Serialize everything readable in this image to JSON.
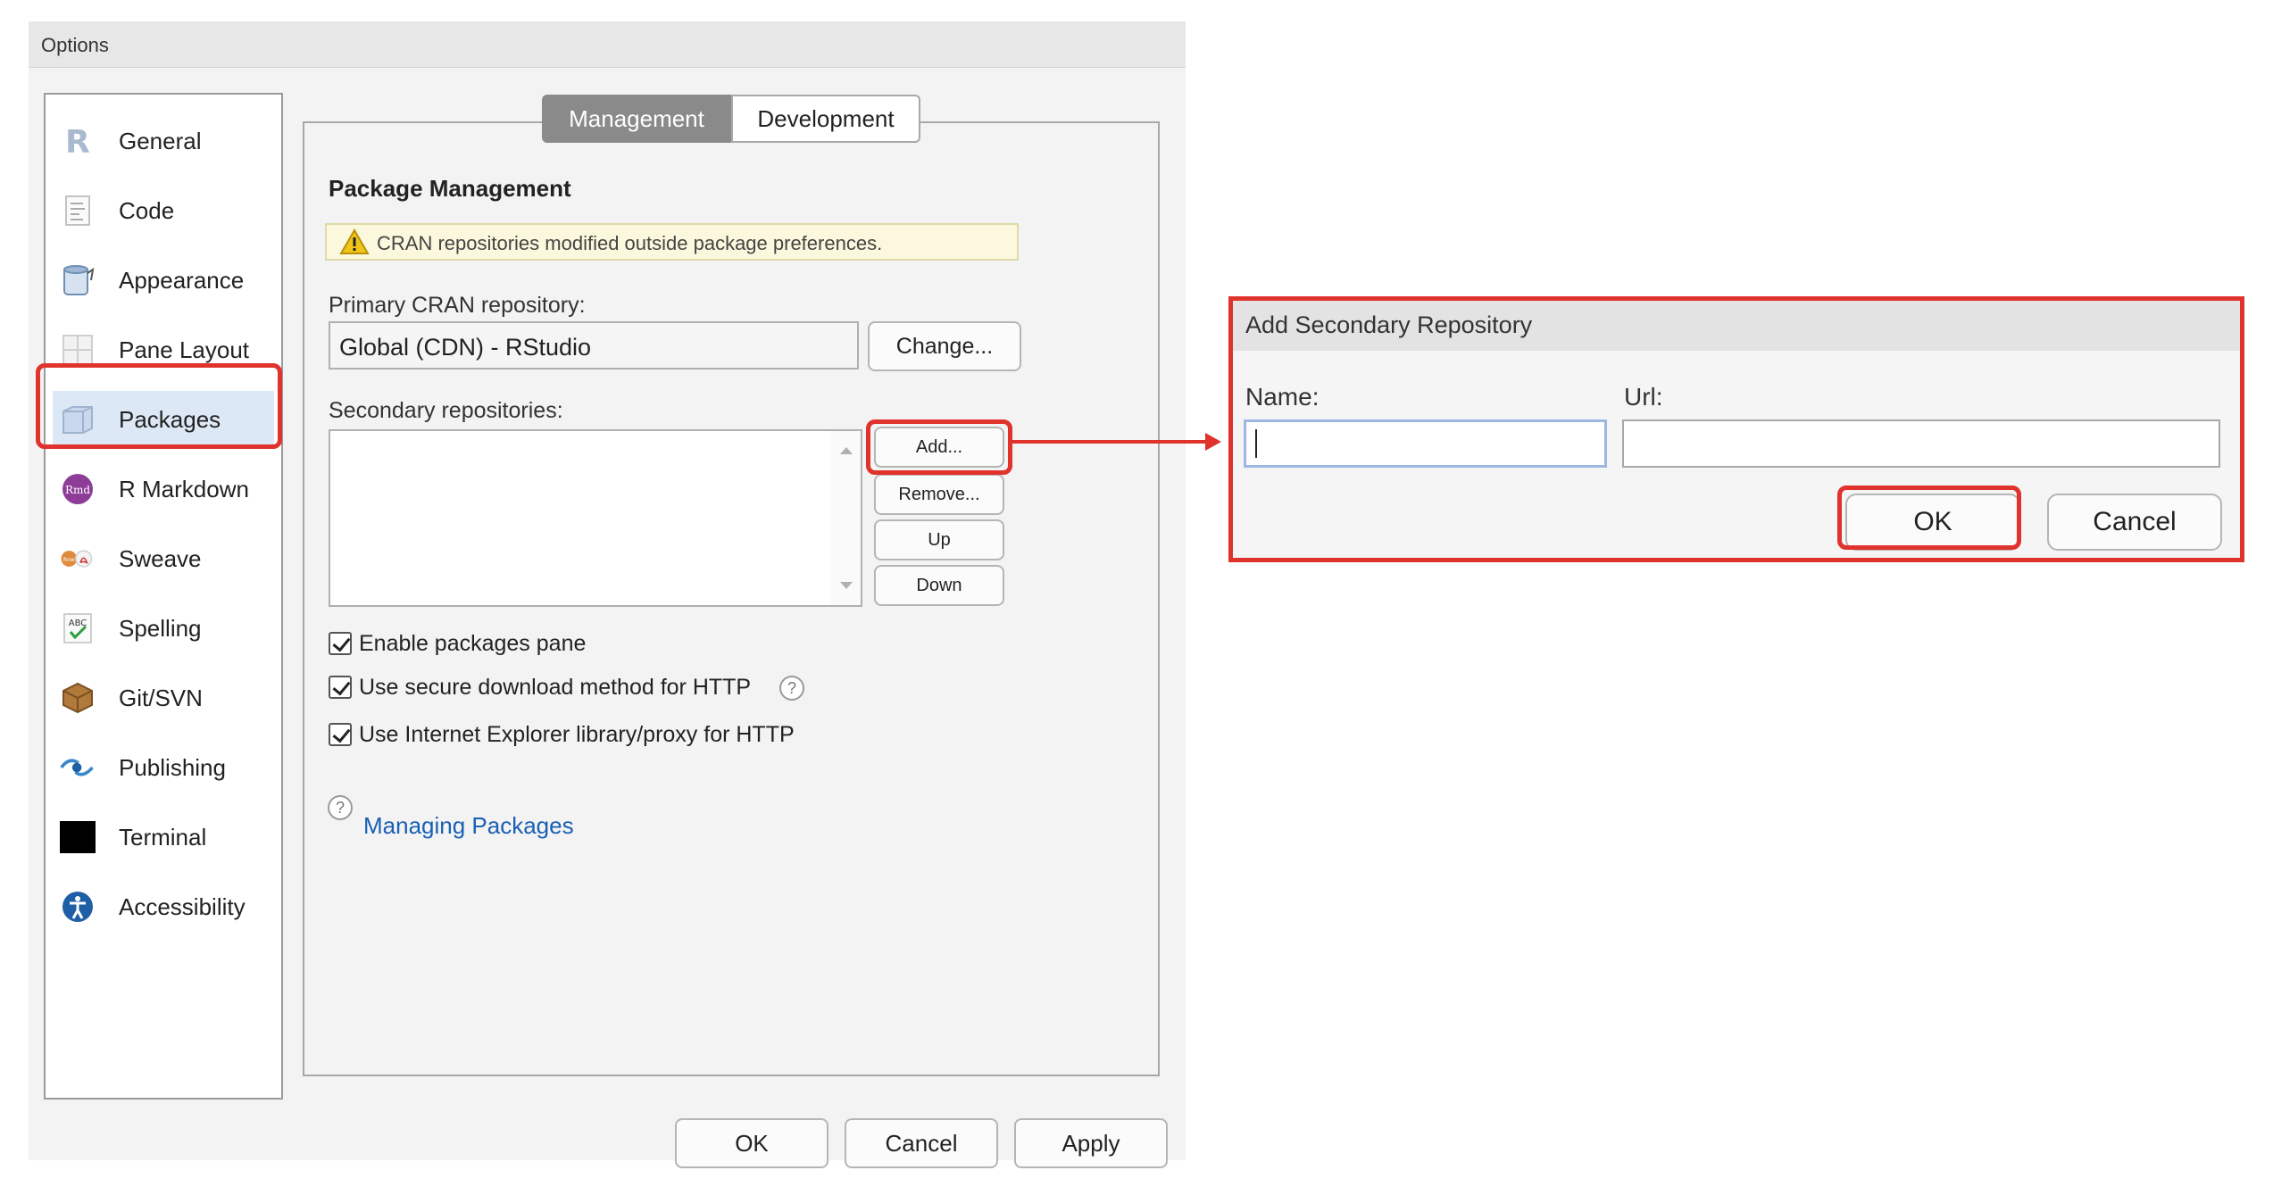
{
  "options": {
    "title": "Options",
    "sidebar": {
      "items": [
        {
          "label": "General",
          "icon": "r-logo-icon"
        },
        {
          "label": "Code",
          "icon": "code-document-icon"
        },
        {
          "label": "Appearance",
          "icon": "appearance-paint-icon"
        },
        {
          "label": "Pane Layout",
          "icon": "pane-layout-icon"
        },
        {
          "label": "Packages",
          "icon": "packages-icon",
          "selected": true
        },
        {
          "label": "R Markdown",
          "icon": "rmd-icon"
        },
        {
          "label": "Sweave",
          "icon": "sweave-pdf-icon"
        },
        {
          "label": "Spelling",
          "icon": "spelling-abc-icon"
        },
        {
          "label": "Git/SVN",
          "icon": "git-box-icon"
        },
        {
          "label": "Publishing",
          "icon": "publishing-icon"
        },
        {
          "label": "Terminal",
          "icon": "terminal-icon"
        },
        {
          "label": "Accessibility",
          "icon": "accessibility-icon"
        }
      ]
    },
    "tabs": {
      "management": "Management",
      "development": "Development",
      "active": "Management"
    },
    "content": {
      "section_title": "Package Management",
      "warning": "CRAN repositories modified outside package preferences.",
      "primary_label": "Primary CRAN repository:",
      "primary_value": "Global (CDN) - RStudio",
      "change_button": "Change...",
      "secondary_label": "Secondary repositories:",
      "add_button": "Add...",
      "remove_button": "Remove...",
      "up_button": "Up",
      "down_button": "Down",
      "checkboxes": [
        {
          "label": "Enable packages pane",
          "checked": true
        },
        {
          "label": "Use secure download method for HTTP",
          "checked": true
        },
        {
          "label": "Use Internet Explorer library/proxy for HTTP",
          "checked": true
        }
      ],
      "help_link": "Managing Packages"
    },
    "footer": {
      "ok": "OK",
      "cancel": "Cancel",
      "apply": "Apply"
    }
  },
  "dialog": {
    "title": "Add Secondary Repository",
    "name_label": "Name:",
    "url_label": "Url:",
    "name_value": "",
    "url_value": "",
    "ok": "OK",
    "cancel": "Cancel"
  },
  "colors": {
    "highlight": "#e0332d",
    "link": "#1a5fb4",
    "selected_bg": "#dde8f6",
    "active_tab": "#8a8a8a"
  }
}
